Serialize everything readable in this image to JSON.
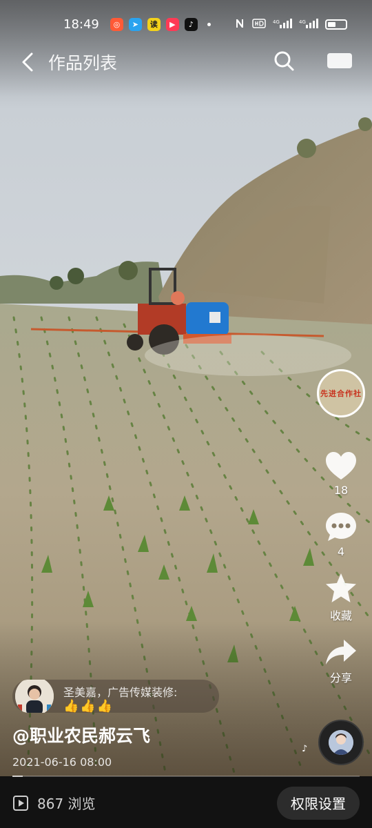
{
  "status_bar": {
    "time": "18:49",
    "app_icons": [
      "xiaohongshu-icon",
      "telegram-icon",
      "reader-icon",
      "video-icon",
      "tiktok-icon"
    ],
    "app_icon_colors": [
      "#ff5a36",
      "#2aa3ef",
      "#f3d21a",
      "#ff3a55",
      "#111111"
    ],
    "battery_level": 0.45
  },
  "header": {
    "title": "作品列表"
  },
  "side_actions": {
    "work_thumb_text": "先进合作社",
    "like_count": "18",
    "comment_count": "4",
    "favorite_label": "收藏",
    "share_label": "分享"
  },
  "comment": {
    "text": "圣美嘉，广告传媒装修:",
    "emoji": "👍👍👍"
  },
  "author": {
    "name": "@职业农民郝云飞",
    "date": "2021-06-16 08:00"
  },
  "playback": {
    "progress": 0.03
  },
  "bottom_bar": {
    "views": "867 浏览",
    "permission_button": "权限设置"
  }
}
